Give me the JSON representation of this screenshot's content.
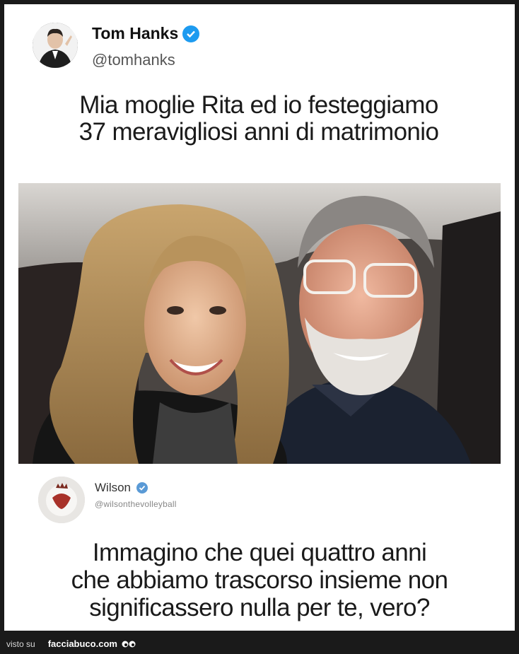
{
  "tweet": {
    "author_name": "Tom Hanks",
    "author_handle": "@tomhanks",
    "text_line1": "Mia moglie Rita ed io festeggiamo",
    "text_line2": "37 meravigliosi anni di matrimonio",
    "verified_color": "#1d9bf0"
  },
  "reply": {
    "author_name": "Wilson",
    "author_handle": "@wilsonthevolleyball",
    "text_line1": "Immagino che quei quattro anni",
    "text_line2": "che abbiamo trascorso insieme non",
    "text_line3": "significassero nulla per te, vero?"
  },
  "watermark": {
    "prefix": "visto su",
    "site": "facciabuco.com"
  }
}
